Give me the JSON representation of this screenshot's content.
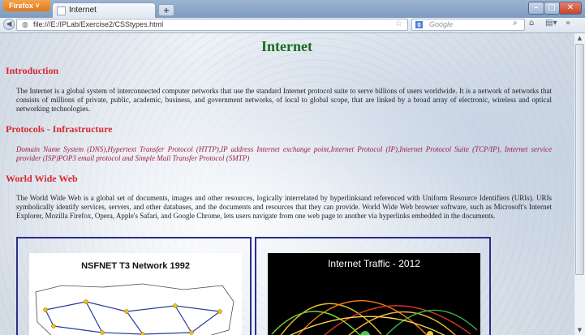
{
  "browser": {
    "menu_label": "Firefox ˅",
    "tab_title": "Internet",
    "new_tab": "+",
    "url": "file:///E:/IPLab/Exercise2/CSStypes.html",
    "search_placeholder": "Google",
    "window_min": "–",
    "window_max": "□",
    "window_close": "✕"
  },
  "page": {
    "title": "Internet",
    "sections": [
      {
        "heading": "Introduction",
        "text": "The Internet is a global system of interconnected computer networks that use the standard Internet protocol suite to serve billions of users worldwide. It is a network of networks that consists of millions of private, public, academic, business, and government networks, of local to global scope, that are linked by a broad array of electronic, wireless and optical networking technologies."
      },
      {
        "heading": "Protocols - Infrastructure",
        "text": "Domain Name System (DNS),Hypertext Transfer Protocol (HTTP),IP address Internet exchange point,Internet Protocol (IP),Internet Protocol Suite (TCP/IP), Internet service provider (ISP)POP3 email protocol and Simple Mail Transfer Protocol (SMTP)"
      },
      {
        "heading": "World Wide Web",
        "text": "The World Wide Web is a global set of documents, images and other resources, logically interrelated by hyperlinksand referenced with Uniform Resource Identifiers (URIs). URIs symbolically identify services, servers, and other databases, and the documents and resources that they can provide. World Wide Web browser software, such as Microsoft's Internet Explorer, Mozilla Firefox, Opera, Apple's Safari, and Google Chrome, lets users navigate from one web page to another via hyperlinks embedded in the documents."
      }
    ],
    "images": [
      {
        "title": "NSFNET T3 Network 1992"
      },
      {
        "title": "Internet Traffic - 2012"
      }
    ]
  },
  "colors": {
    "title": "#1b6b1b",
    "heading": "#d8282f",
    "protocols_text": "#9c1c3f",
    "image_border": "#2a2e8c"
  },
  "icons": [
    "back-icon",
    "globe-icon",
    "bookmark-star-icon",
    "reload-icon",
    "google-icon",
    "search-icon",
    "home-icon",
    "bookmarks-menu-icon"
  ]
}
